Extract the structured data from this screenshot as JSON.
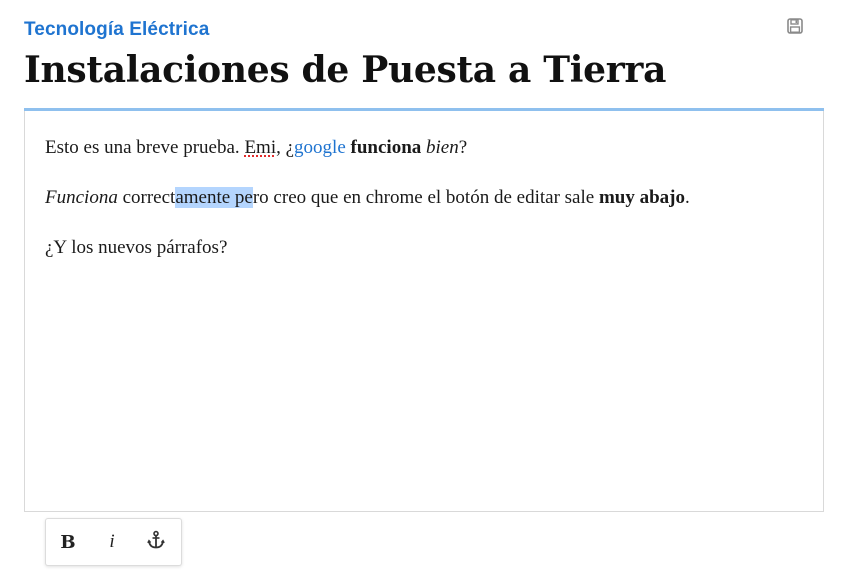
{
  "header": {
    "category": "Tecnología Eléctrica",
    "title": "Instalaciones de Puesta a Tierra",
    "save_icon": "save-icon"
  },
  "editor": {
    "p1": {
      "t1": "Esto es una breve prueba. ",
      "misspelled": "Emi",
      "t2": ", ¿",
      "link": "google",
      "t3": " ",
      "bold": "funciona",
      "t4": " ",
      "italic": "bien",
      "t5": "?"
    },
    "p2": {
      "italic": "Funciona",
      "t1": " correct",
      "selected": "amente pe",
      "t2": "ro creo que en chrome el botón de editar sale ",
      "bold": "muy abajo",
      "t3": "."
    },
    "p3": {
      "text": "¿Y los nuevos párrafos?"
    }
  },
  "toolbar": {
    "bold_label": "B",
    "italic_label": "i",
    "anchor_icon": "anchor-icon"
  },
  "colors": {
    "accent": "#1f74d0",
    "rule": "#8fc0ee",
    "selection": "#b4d5fe"
  }
}
